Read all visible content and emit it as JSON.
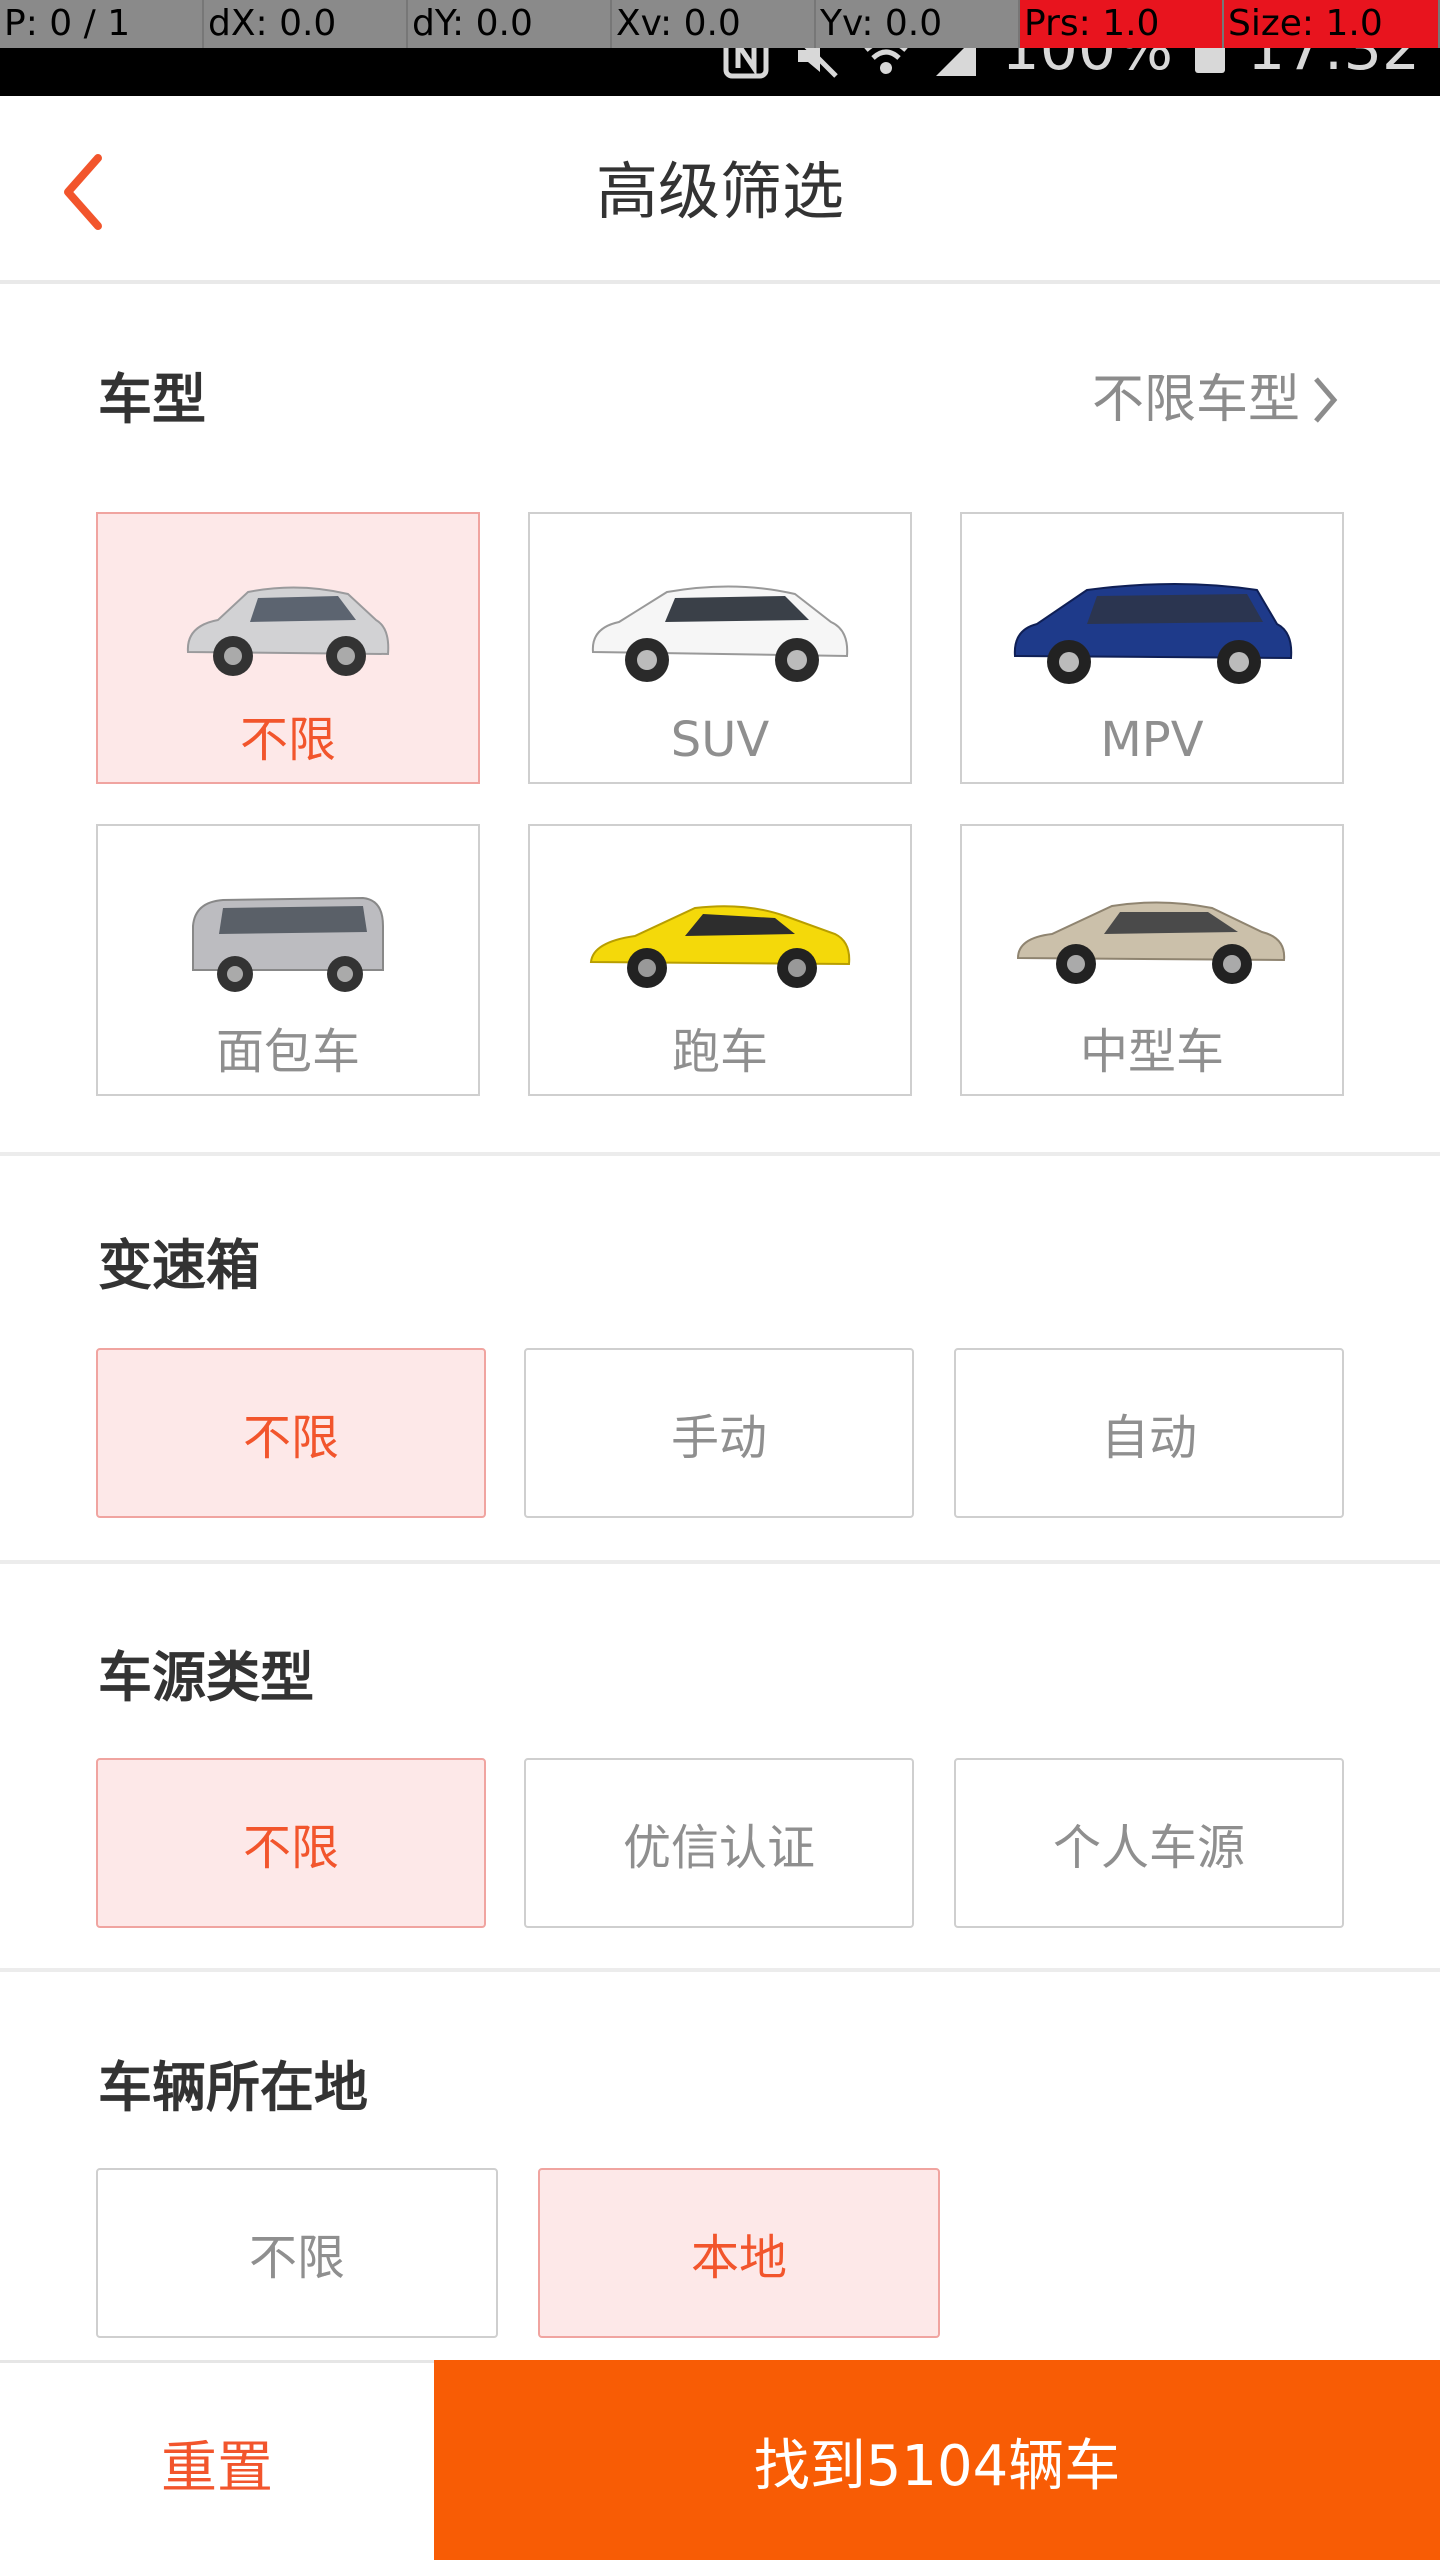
{
  "debug": {
    "p": "P: 0 / 1",
    "dx": "dX: 0.0",
    "dy": "dY: 0.0",
    "xv": "Xv: 0.0",
    "yv": "Yv: 0.0",
    "prs": "Prs: 1.0",
    "size": "Size: 1.0"
  },
  "status": {
    "battery_text": "100%",
    "time": "17:32"
  },
  "header": {
    "title": "高级筛选"
  },
  "car_type": {
    "title": "车型",
    "link": "不限车型",
    "options": [
      {
        "label": "不限",
        "selected": true,
        "icon": "hatchback-car"
      },
      {
        "label": "SUV",
        "selected": false,
        "icon": "suv-car"
      },
      {
        "label": "MPV",
        "selected": false,
        "icon": "mpv-car"
      },
      {
        "label": "面包车",
        "selected": false,
        "icon": "van-car"
      },
      {
        "label": "跑车",
        "selected": false,
        "icon": "sports-car"
      },
      {
        "label": "中型车",
        "selected": false,
        "icon": "sedan-car"
      }
    ],
    "colors": [
      "#c8c8c8",
      "#f4f4f4",
      "#1e3a8a",
      "#b8b8bc",
      "#f4d90a",
      "#cbc0aa"
    ]
  },
  "gearbox": {
    "title": "变速箱",
    "options": [
      {
        "label": "不限",
        "selected": true
      },
      {
        "label": "手动",
        "selected": false
      },
      {
        "label": "自动",
        "selected": false
      }
    ]
  },
  "source": {
    "title": "车源类型",
    "options": [
      {
        "label": "不限",
        "selected": true
      },
      {
        "label": "优信认证",
        "selected": false
      },
      {
        "label": "个人车源",
        "selected": false
      }
    ]
  },
  "location": {
    "title": "车辆所在地",
    "options": [
      {
        "label": "不限",
        "selected": false
      },
      {
        "label": "本地",
        "selected": true
      }
    ]
  },
  "bottom": {
    "reset": "重置",
    "find": "找到5104辆车"
  },
  "accent": "#f85c05"
}
